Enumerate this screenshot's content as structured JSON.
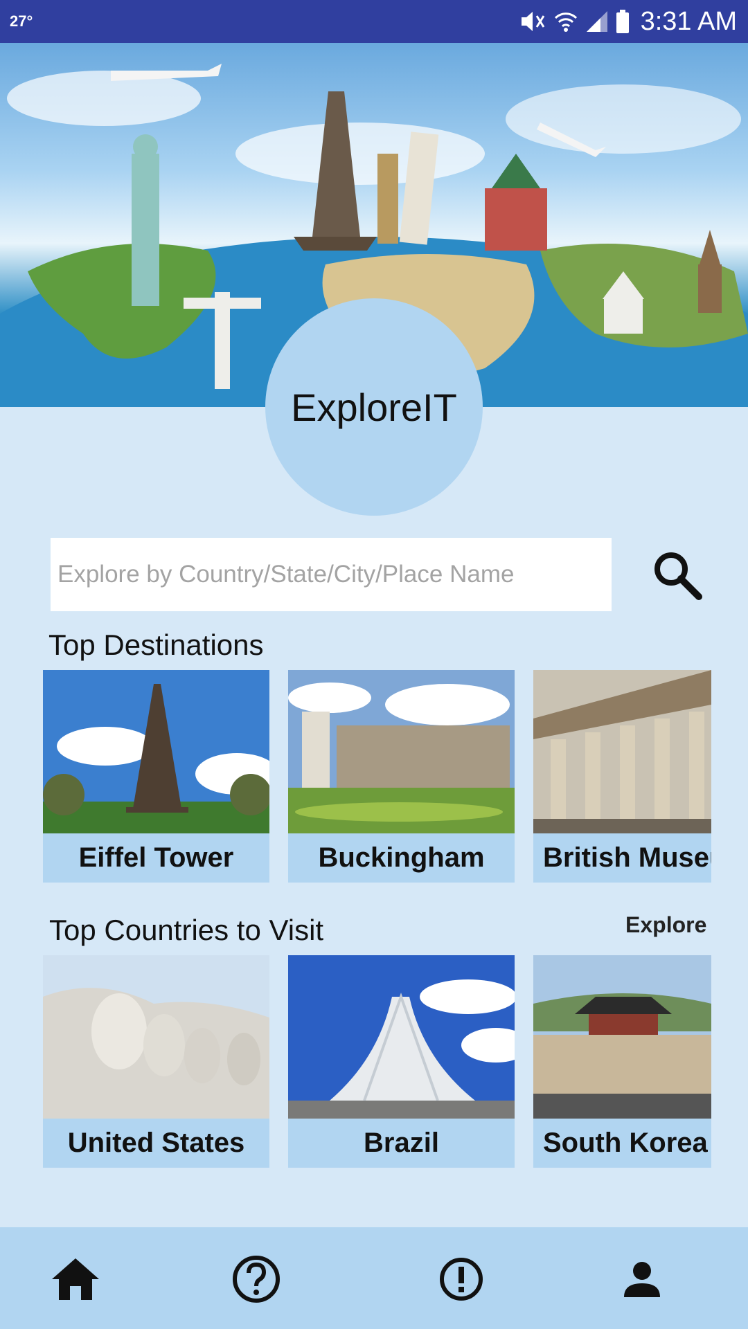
{
  "status_bar": {
    "temperature": "27°",
    "time": "3:31 AM"
  },
  "app": {
    "title": "ExploreIT"
  },
  "search": {
    "placeholder": "Explore by Country/State/City/Place Name"
  },
  "top_destinations": {
    "title": "Top Destinations",
    "items": [
      {
        "label": "Eiffel Tower"
      },
      {
        "label": "Buckingham"
      },
      {
        "label": "British Museum"
      }
    ]
  },
  "top_countries": {
    "title": "Top Countries to Visit",
    "explore_label": "Explore",
    "items": [
      {
        "label": "United States"
      },
      {
        "label": "Brazil"
      },
      {
        "label": "South Korea"
      }
    ]
  },
  "bottom_nav": {
    "items": [
      {
        "icon": "home-icon"
      },
      {
        "icon": "help-icon"
      },
      {
        "icon": "alert-icon"
      },
      {
        "icon": "profile-icon"
      }
    ]
  },
  "colors": {
    "status_bar": "#303f9f",
    "background": "#d6e8f7",
    "accent": "#b1d5f1"
  }
}
